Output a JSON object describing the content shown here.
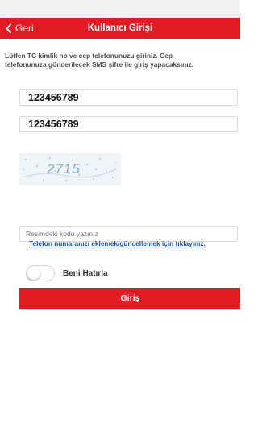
{
  "colors": {
    "brand_red": "#e21b23",
    "link_blue": "#1f4fa8"
  },
  "navbar": {
    "back_label": "Geri",
    "back_icon": "chevron-left-icon",
    "title": "Kullanıcı Girişi"
  },
  "form": {
    "instructions_line1": "Lütfen TC kimlik no ve cep telefonunuzu giriniz. Cep",
    "instructions_line2": "telefonunuza gönderilecek SMS şifre ile giriş yapacaksınız.",
    "tc_value": "123456789",
    "phone_value": "123456789",
    "captcha_text": "2715",
    "captcha_placeholder": "Resimdeki kodu yazınız",
    "update_phone_link": "Telefon numaranızı eklemek/güncellemek için tıklayınız.",
    "remember_label": "Beni Hatırla",
    "remember_on": false,
    "login_button": "Giriş"
  }
}
